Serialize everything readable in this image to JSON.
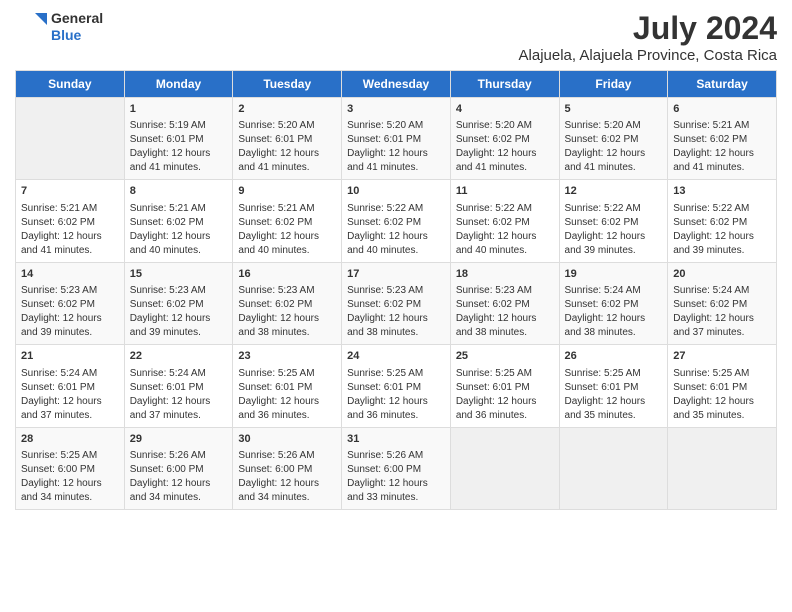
{
  "header": {
    "logo_line1": "General",
    "logo_line2": "Blue",
    "title": "July 2024",
    "subtitle": "Alajuela, Alajuela Province, Costa Rica"
  },
  "calendar": {
    "days_of_week": [
      "Sunday",
      "Monday",
      "Tuesday",
      "Wednesday",
      "Thursday",
      "Friday",
      "Saturday"
    ],
    "weeks": [
      [
        {
          "day": "",
          "content": ""
        },
        {
          "day": "1",
          "content": "Sunrise: 5:19 AM\nSunset: 6:01 PM\nDaylight: 12 hours and 41 minutes."
        },
        {
          "day": "2",
          "content": "Sunrise: 5:20 AM\nSunset: 6:01 PM\nDaylight: 12 hours and 41 minutes."
        },
        {
          "day": "3",
          "content": "Sunrise: 5:20 AM\nSunset: 6:01 PM\nDaylight: 12 hours and 41 minutes."
        },
        {
          "day": "4",
          "content": "Sunrise: 5:20 AM\nSunset: 6:02 PM\nDaylight: 12 hours and 41 minutes."
        },
        {
          "day": "5",
          "content": "Sunrise: 5:20 AM\nSunset: 6:02 PM\nDaylight: 12 hours and 41 minutes."
        },
        {
          "day": "6",
          "content": "Sunrise: 5:21 AM\nSunset: 6:02 PM\nDaylight: 12 hours and 41 minutes."
        }
      ],
      [
        {
          "day": "7",
          "content": "Sunrise: 5:21 AM\nSunset: 6:02 PM\nDaylight: 12 hours and 41 minutes."
        },
        {
          "day": "8",
          "content": "Sunrise: 5:21 AM\nSunset: 6:02 PM\nDaylight: 12 hours and 40 minutes."
        },
        {
          "day": "9",
          "content": "Sunrise: 5:21 AM\nSunset: 6:02 PM\nDaylight: 12 hours and 40 minutes."
        },
        {
          "day": "10",
          "content": "Sunrise: 5:22 AM\nSunset: 6:02 PM\nDaylight: 12 hours and 40 minutes."
        },
        {
          "day": "11",
          "content": "Sunrise: 5:22 AM\nSunset: 6:02 PM\nDaylight: 12 hours and 40 minutes."
        },
        {
          "day": "12",
          "content": "Sunrise: 5:22 AM\nSunset: 6:02 PM\nDaylight: 12 hours and 39 minutes."
        },
        {
          "day": "13",
          "content": "Sunrise: 5:22 AM\nSunset: 6:02 PM\nDaylight: 12 hours and 39 minutes."
        }
      ],
      [
        {
          "day": "14",
          "content": "Sunrise: 5:23 AM\nSunset: 6:02 PM\nDaylight: 12 hours and 39 minutes."
        },
        {
          "day": "15",
          "content": "Sunrise: 5:23 AM\nSunset: 6:02 PM\nDaylight: 12 hours and 39 minutes."
        },
        {
          "day": "16",
          "content": "Sunrise: 5:23 AM\nSunset: 6:02 PM\nDaylight: 12 hours and 38 minutes."
        },
        {
          "day": "17",
          "content": "Sunrise: 5:23 AM\nSunset: 6:02 PM\nDaylight: 12 hours and 38 minutes."
        },
        {
          "day": "18",
          "content": "Sunrise: 5:23 AM\nSunset: 6:02 PM\nDaylight: 12 hours and 38 minutes."
        },
        {
          "day": "19",
          "content": "Sunrise: 5:24 AM\nSunset: 6:02 PM\nDaylight: 12 hours and 38 minutes."
        },
        {
          "day": "20",
          "content": "Sunrise: 5:24 AM\nSunset: 6:02 PM\nDaylight: 12 hours and 37 minutes."
        }
      ],
      [
        {
          "day": "21",
          "content": "Sunrise: 5:24 AM\nSunset: 6:01 PM\nDaylight: 12 hours and 37 minutes."
        },
        {
          "day": "22",
          "content": "Sunrise: 5:24 AM\nSunset: 6:01 PM\nDaylight: 12 hours and 37 minutes."
        },
        {
          "day": "23",
          "content": "Sunrise: 5:25 AM\nSunset: 6:01 PM\nDaylight: 12 hours and 36 minutes."
        },
        {
          "day": "24",
          "content": "Sunrise: 5:25 AM\nSunset: 6:01 PM\nDaylight: 12 hours and 36 minutes."
        },
        {
          "day": "25",
          "content": "Sunrise: 5:25 AM\nSunset: 6:01 PM\nDaylight: 12 hours and 36 minutes."
        },
        {
          "day": "26",
          "content": "Sunrise: 5:25 AM\nSunset: 6:01 PM\nDaylight: 12 hours and 35 minutes."
        },
        {
          "day": "27",
          "content": "Sunrise: 5:25 AM\nSunset: 6:01 PM\nDaylight: 12 hours and 35 minutes."
        }
      ],
      [
        {
          "day": "28",
          "content": "Sunrise: 5:25 AM\nSunset: 6:00 PM\nDaylight: 12 hours and 34 minutes."
        },
        {
          "day": "29",
          "content": "Sunrise: 5:26 AM\nSunset: 6:00 PM\nDaylight: 12 hours and 34 minutes."
        },
        {
          "day": "30",
          "content": "Sunrise: 5:26 AM\nSunset: 6:00 PM\nDaylight: 12 hours and 34 minutes."
        },
        {
          "day": "31",
          "content": "Sunrise: 5:26 AM\nSunset: 6:00 PM\nDaylight: 12 hours and 33 minutes."
        },
        {
          "day": "",
          "content": ""
        },
        {
          "day": "",
          "content": ""
        },
        {
          "day": "",
          "content": ""
        }
      ]
    ]
  }
}
